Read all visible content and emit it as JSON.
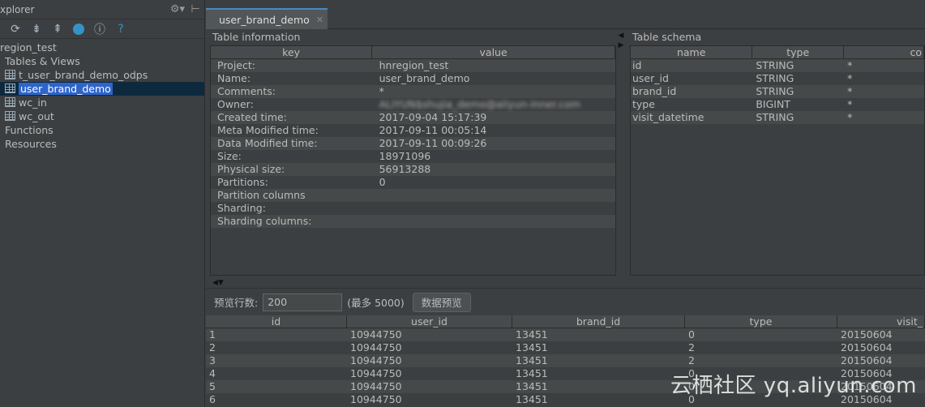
{
  "explorer": {
    "title": "xplorer",
    "tree": {
      "project": "region_test",
      "tables_views": "Tables & Views",
      "tables": [
        "t_user_brand_demo_odps",
        "user_brand_demo",
        "wc_in",
        "wc_out"
      ],
      "selected_index": 1,
      "functions": "Functions",
      "resources": "Resources"
    }
  },
  "editor_tab": {
    "label": "user_brand_demo"
  },
  "table_info": {
    "title": "Table information",
    "headers": [
      "key",
      "value"
    ],
    "rows": [
      {
        "key": "Project:",
        "value": "hnregion_test"
      },
      {
        "key": "Name:",
        "value": "user_brand_demo"
      },
      {
        "key": "Comments:",
        "value": "*"
      },
      {
        "key": "Owner:",
        "value": "ALIYUN$shujia_demo@aliyun-inner.com"
      },
      {
        "key": "Created time:",
        "value": "2017-09-04 15:17:39"
      },
      {
        "key": "Meta Modified time:",
        "value": "2017-09-11 00:05:14"
      },
      {
        "key": "Data Modified time:",
        "value": "2017-09-11 00:09:26"
      },
      {
        "key": "Size:",
        "value": "18971096"
      },
      {
        "key": "Physical size:",
        "value": "56913288"
      },
      {
        "key": "Partitions:",
        "value": "0"
      },
      {
        "key": "Partition columns",
        "value": ""
      },
      {
        "key": "Sharding:",
        "value": ""
      },
      {
        "key": "Sharding columns:",
        "value": ""
      }
    ]
  },
  "table_schema": {
    "title": "Table schema",
    "headers": [
      "name",
      "type",
      "co"
    ],
    "rows": [
      {
        "name": "id",
        "type": "STRING",
        "comment": "*"
      },
      {
        "name": "user_id",
        "type": "STRING",
        "comment": "*"
      },
      {
        "name": "brand_id",
        "type": "STRING",
        "comment": "*"
      },
      {
        "name": "type",
        "type": "BIGINT",
        "comment": "*"
      },
      {
        "name": "visit_datetime",
        "type": "STRING",
        "comment": "*"
      }
    ]
  },
  "preview": {
    "rows_label": "预览行数:",
    "rows_value": "200",
    "max_label": "(最多 5000)",
    "button_label": "数据预览"
  },
  "data_preview": {
    "headers": [
      "id",
      "user_id",
      "brand_id",
      "type",
      "visit_"
    ],
    "rows": [
      [
        "1",
        "10944750",
        "13451",
        "0",
        "20150604"
      ],
      [
        "2",
        "10944750",
        "13451",
        "2",
        "20150604"
      ],
      [
        "3",
        "10944750",
        "13451",
        "2",
        "20150604"
      ],
      [
        "4",
        "10944750",
        "13451",
        "0",
        "20150604"
      ],
      [
        "5",
        "10944750",
        "13451",
        "0",
        "20150604"
      ],
      [
        "6",
        "10944750",
        "13451",
        "0",
        "20150604"
      ]
    ]
  },
  "watermark": "云栖社区 yq.aliyun.com"
}
